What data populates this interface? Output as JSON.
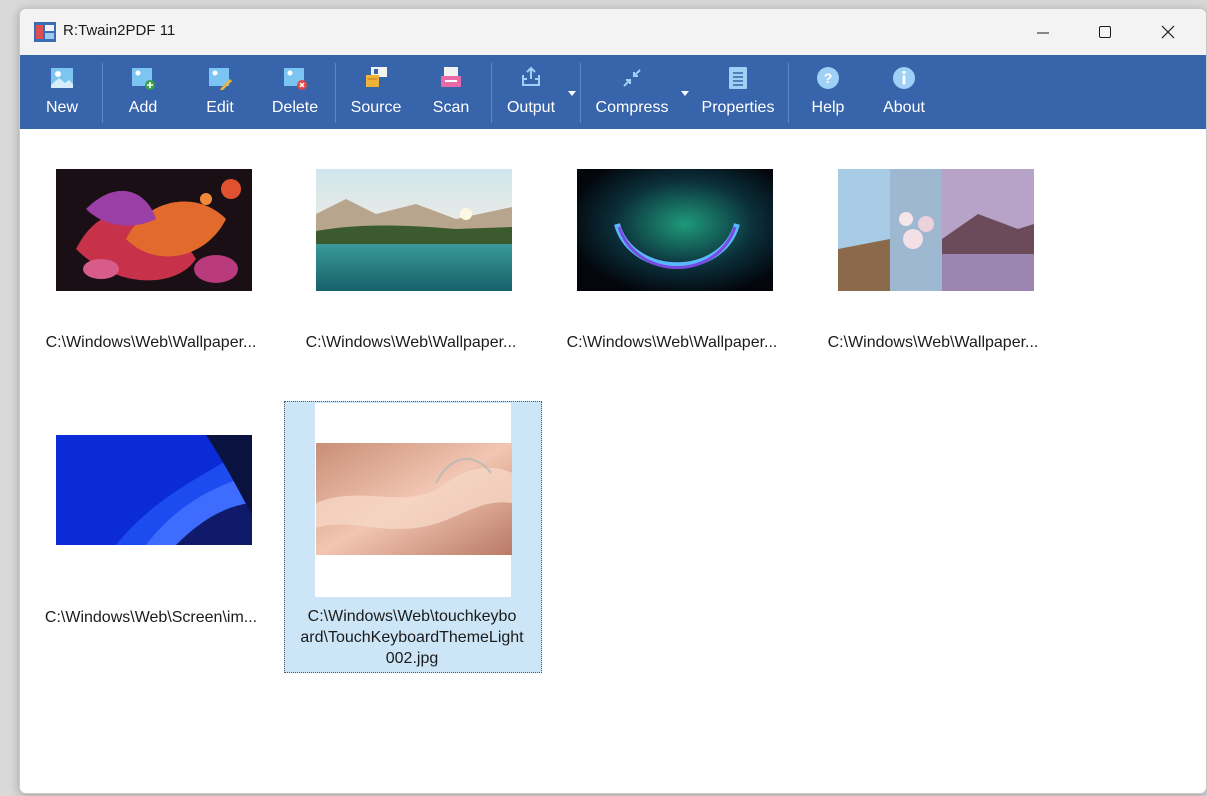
{
  "window": {
    "title": "R:Twain2PDF 11",
    "controls": {
      "minimize": "minimize",
      "maximize": "maximize",
      "close": "close"
    }
  },
  "toolbar": {
    "new": "New",
    "add": "Add",
    "edit": "Edit",
    "delete": "Delete",
    "source": "Source",
    "scan": "Scan",
    "output": "Output",
    "compress": "Compress",
    "properties": "Properties",
    "help": "Help",
    "about": "About"
  },
  "images": [
    {
      "caption": "C:\\Windows\\Web\\Wallpaper...",
      "thumbnail": "abstract-bloom-wallpaper"
    },
    {
      "caption": "C:\\Windows\\Web\\Wallpaper...",
      "thumbnail": "lake-landscape-wallpaper"
    },
    {
      "caption": "C:\\Windows\\Web\\Wallpaper...",
      "thumbnail": "glow-arc-wallpaper"
    },
    {
      "caption": "C:\\Windows\\Web\\Wallpaper...",
      "thumbnail": "blossom-triptych-wallpaper"
    },
    {
      "caption": "C:\\Windows\\Web\\Screen\\im...",
      "thumbnail": "blue-bloom-wallpaper"
    },
    {
      "caption_lines": [
        "C:\\Windows\\Web\\touchkeybo",
        "ard\\TouchKeyboardThemeLight",
        "002.jpg"
      ],
      "thumbnail": "silk-fabric-wallpaper",
      "selected": true
    }
  ],
  "colors": {
    "toolbar": "#3764aa",
    "selection": "#cde6f7",
    "titlebar": "#f3f3f3"
  }
}
